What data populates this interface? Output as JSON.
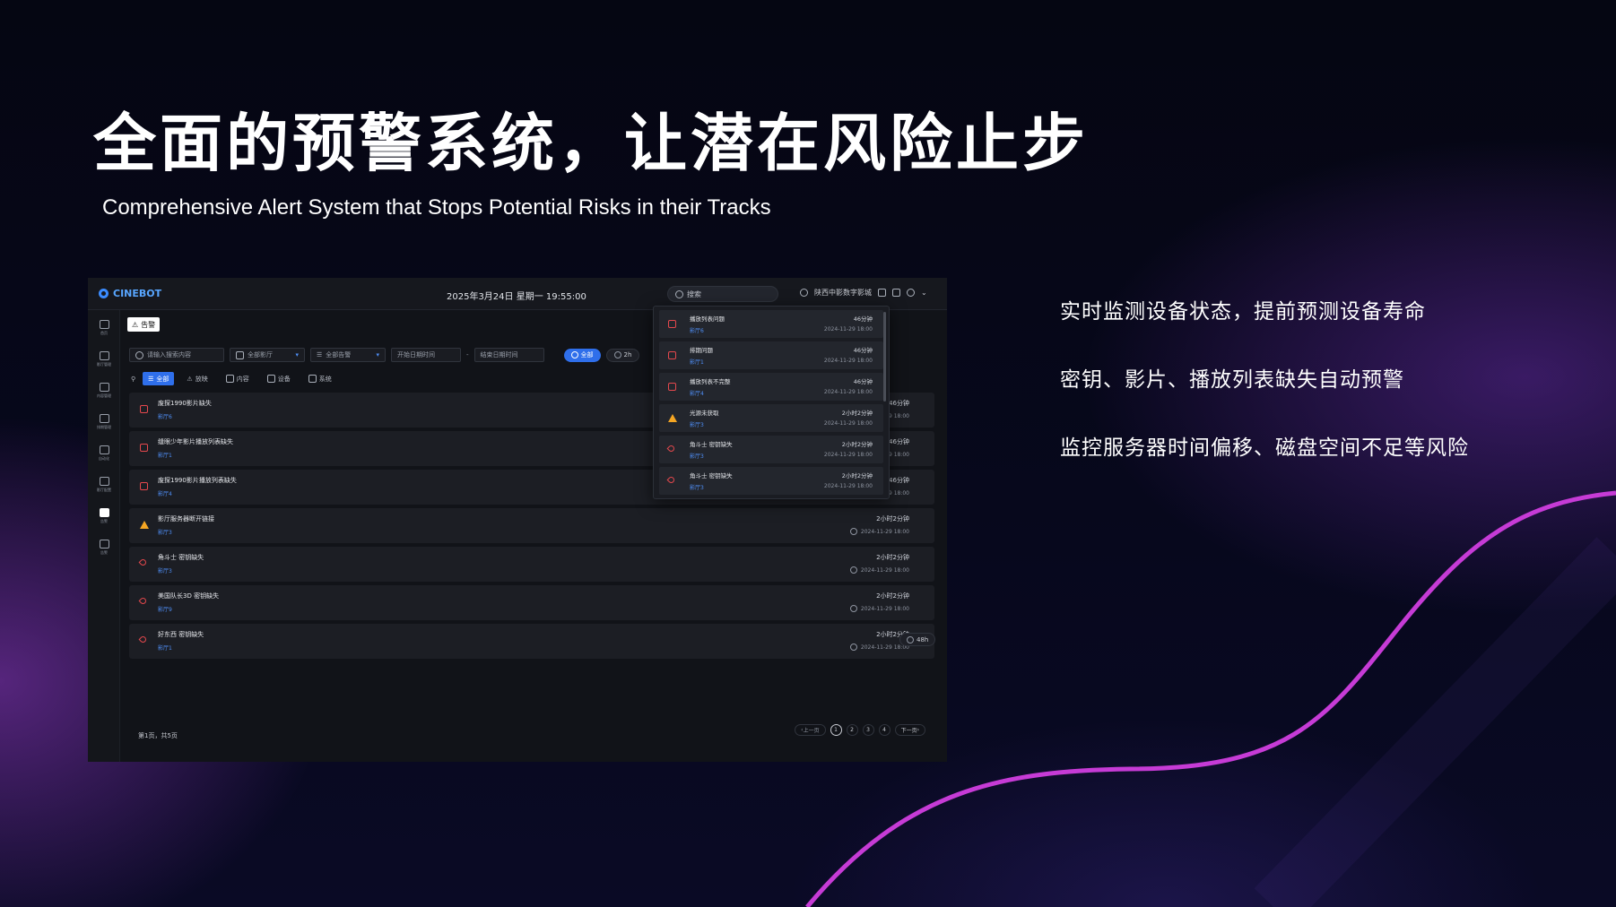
{
  "slide": {
    "title": "全面的预警系统，让潜在风险止步",
    "subtitle": "Comprehensive Alert System that Stops Potential Risks in their Tracks",
    "bullets": [
      "实时监测设备状态，提前预测设备寿命",
      "密钥、影片、播放列表缺失自动预警",
      "监控服务器时间偏移、磁盘空间不足等风险"
    ],
    "curve_color": "#c63bd6"
  },
  "app": {
    "logo": "CINEBOT",
    "datetime": "2025年3月24日   星期一    19:55:00",
    "search_placeholder": "搜索",
    "cinema_name": "陕西中影数字影城",
    "sidebar": [
      {
        "label": "首页",
        "icon": "home-icon"
      },
      {
        "label": "影厅管理",
        "icon": "screen-icon"
      },
      {
        "label": "内容管理",
        "icon": "content-icon"
      },
      {
        "label": "排期管理",
        "icon": "calendar-icon"
      },
      {
        "label": "自动化",
        "icon": "automation-icon"
      },
      {
        "label": "影厅配置",
        "icon": "config-icon"
      },
      {
        "label": "告警",
        "icon": "alert-icon"
      },
      {
        "label": "告警",
        "icon": "warning-icon"
      }
    ],
    "alert_tag": "告警",
    "filters": {
      "search_placeholder": "请输入搜索内容",
      "hall_select": "全部影厅",
      "alert_select": "全部告警",
      "start_date": "开始日期时间",
      "date_sep": "-",
      "end_date": "结束日期时间",
      "time_all": "全部",
      "time_2h": "2h",
      "time_48h": "48h"
    },
    "tabs": [
      "全部",
      "放映",
      "内容",
      "设备",
      "系统"
    ],
    "alerts": [
      {
        "title": "废探1990影片缺失",
        "hall": "影厅6",
        "ago": "46分钟",
        "time": "2024-11-29 18:00",
        "kind": "calendar"
      },
      {
        "title": "缝眼少年影片播放列表缺失",
        "hall": "影厅1",
        "ago": "46分钟",
        "time": "2024-11-29 18:00",
        "kind": "calendar"
      },
      {
        "title": "废探1990影片播放列表缺失",
        "hall": "影厅4",
        "ago": "46分钟",
        "time": "2024-11-29 18:00",
        "kind": "calendar"
      },
      {
        "title": "影厅服务器断开链接",
        "hall": "影厅3",
        "ago": "2小时2分钟",
        "time": "2024-11-29 18:00",
        "kind": "warning"
      },
      {
        "title": "角斗士 密钥缺失",
        "hall": "影厅3",
        "ago": "2小时2分钟",
        "time": "2024-11-29 18:00",
        "kind": "key"
      },
      {
        "title": "美国队长3D 密钥缺失",
        "hall": "影厅9",
        "ago": "2小时2分钟",
        "time": "2024-11-29 18:00",
        "kind": "key"
      },
      {
        "title": "好东西 密钥缺失",
        "hall": "影厅1",
        "ago": "2小时2分钟",
        "time": "2024-11-29 18:00",
        "kind": "key"
      }
    ],
    "dropdown": [
      {
        "title": "播放列表问题",
        "hall": "影厅6",
        "ago": "46分钟",
        "time": "2024-11-29 18:00",
        "kind": "calendar"
      },
      {
        "title": "排期问题",
        "hall": "影厅1",
        "ago": "46分钟",
        "time": "2024-11-29 18:00",
        "kind": "calendar"
      },
      {
        "title": "播放列表不完整",
        "hall": "影厅4",
        "ago": "46分钟",
        "time": "2024-11-29 18:00",
        "kind": "calendar"
      },
      {
        "title": "光源未获取",
        "hall": "影厅3",
        "ago": "2小时2分钟",
        "time": "2024-11-29 18:00",
        "kind": "warning"
      },
      {
        "title": "角斗士 密钥缺失",
        "hall": "影厅3",
        "ago": "2小时2分钟",
        "time": "2024-11-29 18:00",
        "kind": "key"
      },
      {
        "title": "角斗士 密钥缺失",
        "hall": "影厅3",
        "ago": "2小时2分钟",
        "time": "2024-11-29 18:00",
        "kind": "key"
      }
    ],
    "pager": {
      "info": "第1页，共5页",
      "prev": "上一页",
      "next": "下一页",
      "pages": [
        "1",
        "2",
        "3",
        "4"
      ]
    }
  }
}
